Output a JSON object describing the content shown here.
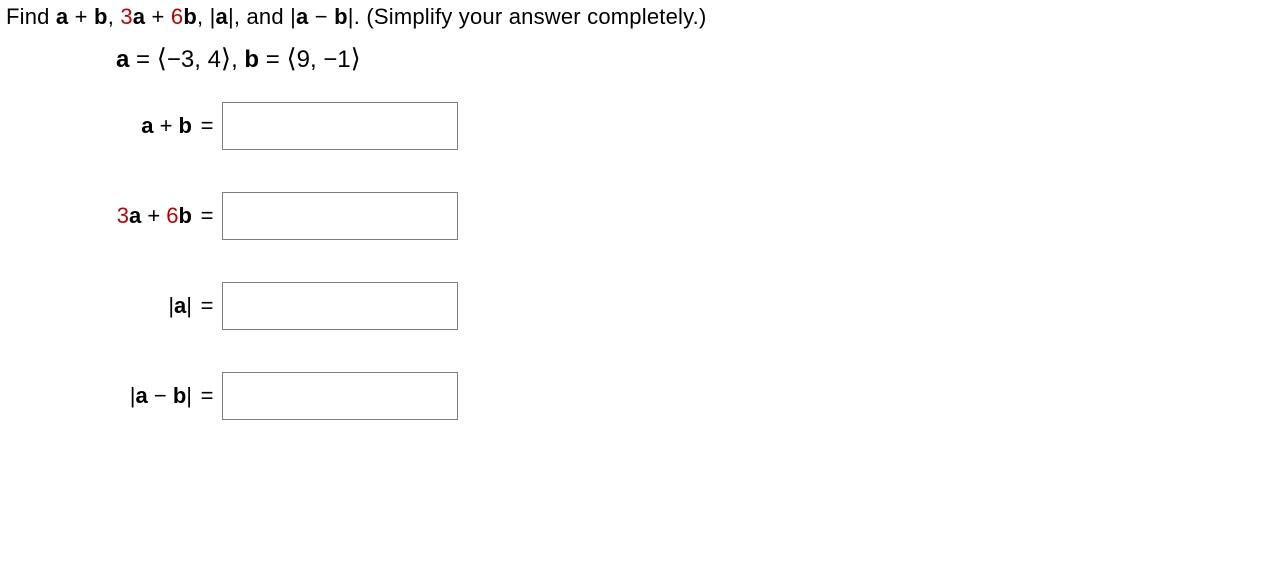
{
  "prompt": {
    "find": "Find  ",
    "e1_a": "a",
    "e1_plus": " + ",
    "e1_b": "b",
    "sep": ", ",
    "e2_3": "3",
    "e2_a": "a",
    "e2_plus": " + ",
    "e2_6": "6",
    "e2_b": "b",
    "e3_bar1": "|",
    "e3_a": "a",
    "e3_bar2": "|",
    "and": ", and ",
    "e4_bar1": "|",
    "e4_a": "a",
    "e4_minus": " − ",
    "e4_b": "b",
    "e4_bar2": "|",
    "period": ".  ",
    "hint": "(Simplify your answer completely.)"
  },
  "given": {
    "a_label": "a",
    "a_eq": " = ",
    "a_open": "⟨",
    "a_vals": "−3, 4",
    "a_close": "⟩",
    "gap": ",    ",
    "b_label": "b",
    "b_eq": " = ",
    "b_open": "⟨",
    "b_vals": "9, −1",
    "b_close": "⟩"
  },
  "rows": {
    "r1": {
      "a": "a",
      "plus": " + ",
      "b": "b",
      "eq": "="
    },
    "r2": {
      "three": "3",
      "a": "a",
      "plus": " + ",
      "six": "6",
      "b": "b",
      "eq": "="
    },
    "r3": {
      "bar1": "|",
      "a": "a",
      "bar2": "|",
      "eq": "="
    },
    "r4": {
      "bar1": "|",
      "a": "a",
      "minus": " − ",
      "b": "b",
      "bar2": "|",
      "eq": "="
    }
  },
  "answers": {
    "r1": "",
    "r2": "",
    "r3": "",
    "r4": ""
  }
}
